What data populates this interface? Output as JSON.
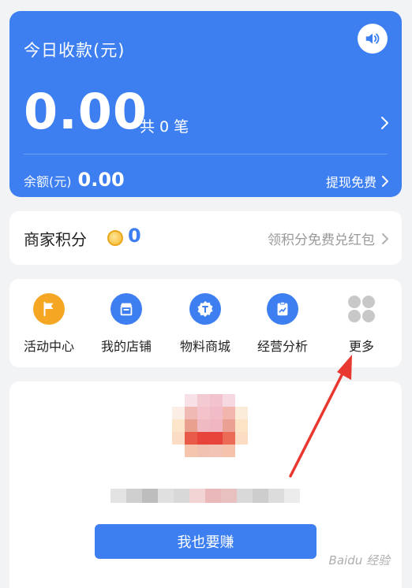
{
  "summary": {
    "title": "今日收款(元)",
    "amount": "0.00",
    "count_text": "共 0 笔",
    "balance_label": "余额(元)",
    "balance_value": "0.00",
    "withdraw_label": "提现免费"
  },
  "points": {
    "label": "商家积分",
    "value": "0",
    "redeem_label": "领积分免费兑红包"
  },
  "menu": [
    {
      "label": "活动中心",
      "icon": "flag-icon",
      "color": "#f5a623"
    },
    {
      "label": "我的店铺",
      "icon": "store-icon",
      "color": "#3d7ff0"
    },
    {
      "label": "物料商城",
      "icon": "t-badge-icon",
      "color": "#3d7ff0"
    },
    {
      "label": "经营分析",
      "icon": "analytics-icon",
      "color": "#3d7ff0"
    },
    {
      "label": "更多",
      "icon": "more-grid-icon",
      "color": "#c8c8c8"
    }
  ],
  "promo": {
    "cta_label": "我也要赚"
  },
  "watermark": "Baidu 经验",
  "colors": {
    "primary": "#3d7ff0",
    "annotation_arrow": "#e8382f"
  }
}
